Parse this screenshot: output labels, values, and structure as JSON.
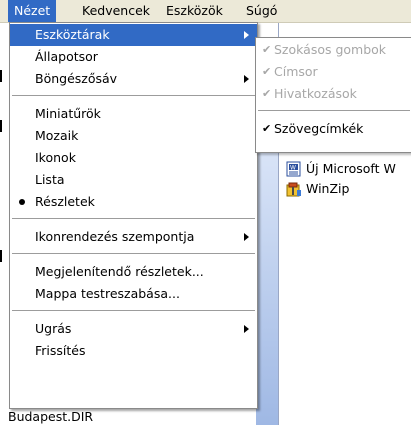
{
  "menubar": {
    "items": [
      {
        "label": "Nézet",
        "active": true
      },
      {
        "label": "Kedvencek"
      },
      {
        "label": "Eszközök"
      },
      {
        "label": "Súgó"
      }
    ]
  },
  "dropdown": {
    "items": [
      {
        "label": "Eszköztárak",
        "submenu": true,
        "highlighted": true
      },
      {
        "label": "Állapotsor"
      },
      {
        "label": "Böngészősáv",
        "submenu": true
      },
      {
        "separator": true
      },
      {
        "label": "Miniatűrök"
      },
      {
        "label": "Mozaik"
      },
      {
        "label": "Ikonok"
      },
      {
        "label": "Lista"
      },
      {
        "label": "Részletek",
        "bullet": true
      },
      {
        "separator": true
      },
      {
        "label": "Ikonrendezés szempontja",
        "submenu": true
      },
      {
        "separator": true
      },
      {
        "label": "Megjelenítendő részletek..."
      },
      {
        "label": "Mappa testreszabása..."
      },
      {
        "separator": true
      },
      {
        "label": "Ugrás",
        "submenu": true
      },
      {
        "label": "Frissítés"
      }
    ]
  },
  "submenu": {
    "items": [
      {
        "label": "Szokásos gombok",
        "checked": true,
        "disabled": true
      },
      {
        "label": "Címsor",
        "checked": true,
        "disabled": true
      },
      {
        "label": "Hivatkozások",
        "checked": true,
        "disabled": true
      },
      {
        "separator": true
      },
      {
        "label": "Szövegcímkék",
        "checked": true,
        "disabled": false
      }
    ]
  },
  "files": [
    {
      "label": "Új Microsoft W",
      "icon": "word-document-icon"
    },
    {
      "label": "WinZip",
      "icon": "winzip-icon"
    }
  ],
  "status": {
    "bottom_label": "Budapest.DIR"
  },
  "colors": {
    "highlight": "#316ac5",
    "menubar": "#ece9d8",
    "disabled_text": "#a7a7a7"
  }
}
